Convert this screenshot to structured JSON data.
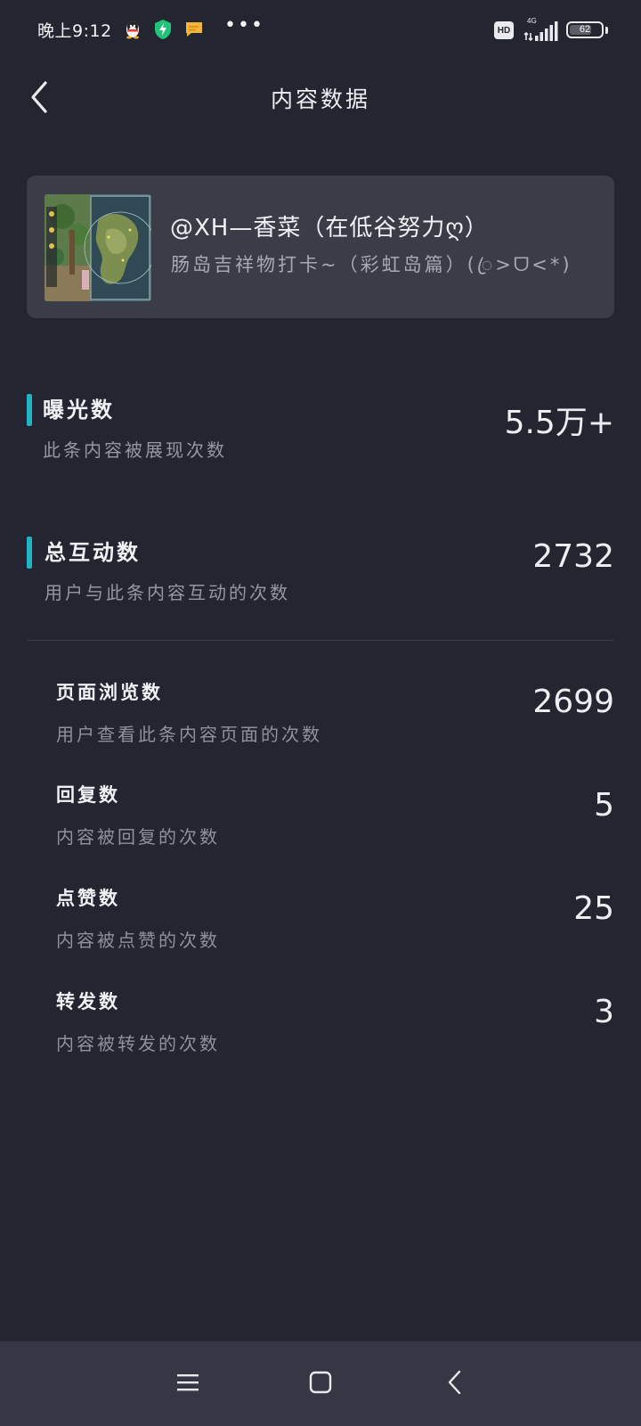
{
  "status_bar": {
    "time": "晚上9:12",
    "more_dots": "•••",
    "hd_label": "HD",
    "network_label": "4G",
    "battery_level": "62"
  },
  "header": {
    "title": "内容数据"
  },
  "post": {
    "author": "@XH—香菜（在低谷努力ღ）",
    "title": "肠岛吉祥物打卡~（彩虹岛篇）(ꦿ>ᗜ<*)"
  },
  "metrics": {
    "exposure": {
      "label": "曝光数",
      "description": "此条内容被展现次数",
      "value": "5.5万+"
    },
    "interaction": {
      "label": "总互动数",
      "description": "用户与此条内容互动的次数",
      "value": "2732"
    },
    "page_views": {
      "label": "页面浏览数",
      "description": "用户查看此条内容页面的次数",
      "value": "2699"
    },
    "replies": {
      "label": "回复数",
      "description": "内容被回复的次数",
      "value": "5"
    },
    "likes": {
      "label": "点赞数",
      "description": "内容被点赞的次数",
      "value": "25"
    },
    "shares": {
      "label": "转发数",
      "description": "内容被转发的次数",
      "value": "3"
    }
  },
  "icons": {
    "back": "chevron-left-icon",
    "menu": "menu-icon",
    "home": "home-icon",
    "nav_back": "back-icon"
  },
  "colors": {
    "background": "#232531",
    "card": "#3a3c48",
    "accent": "#1fb3c4",
    "nav_bar": "#353745"
  }
}
